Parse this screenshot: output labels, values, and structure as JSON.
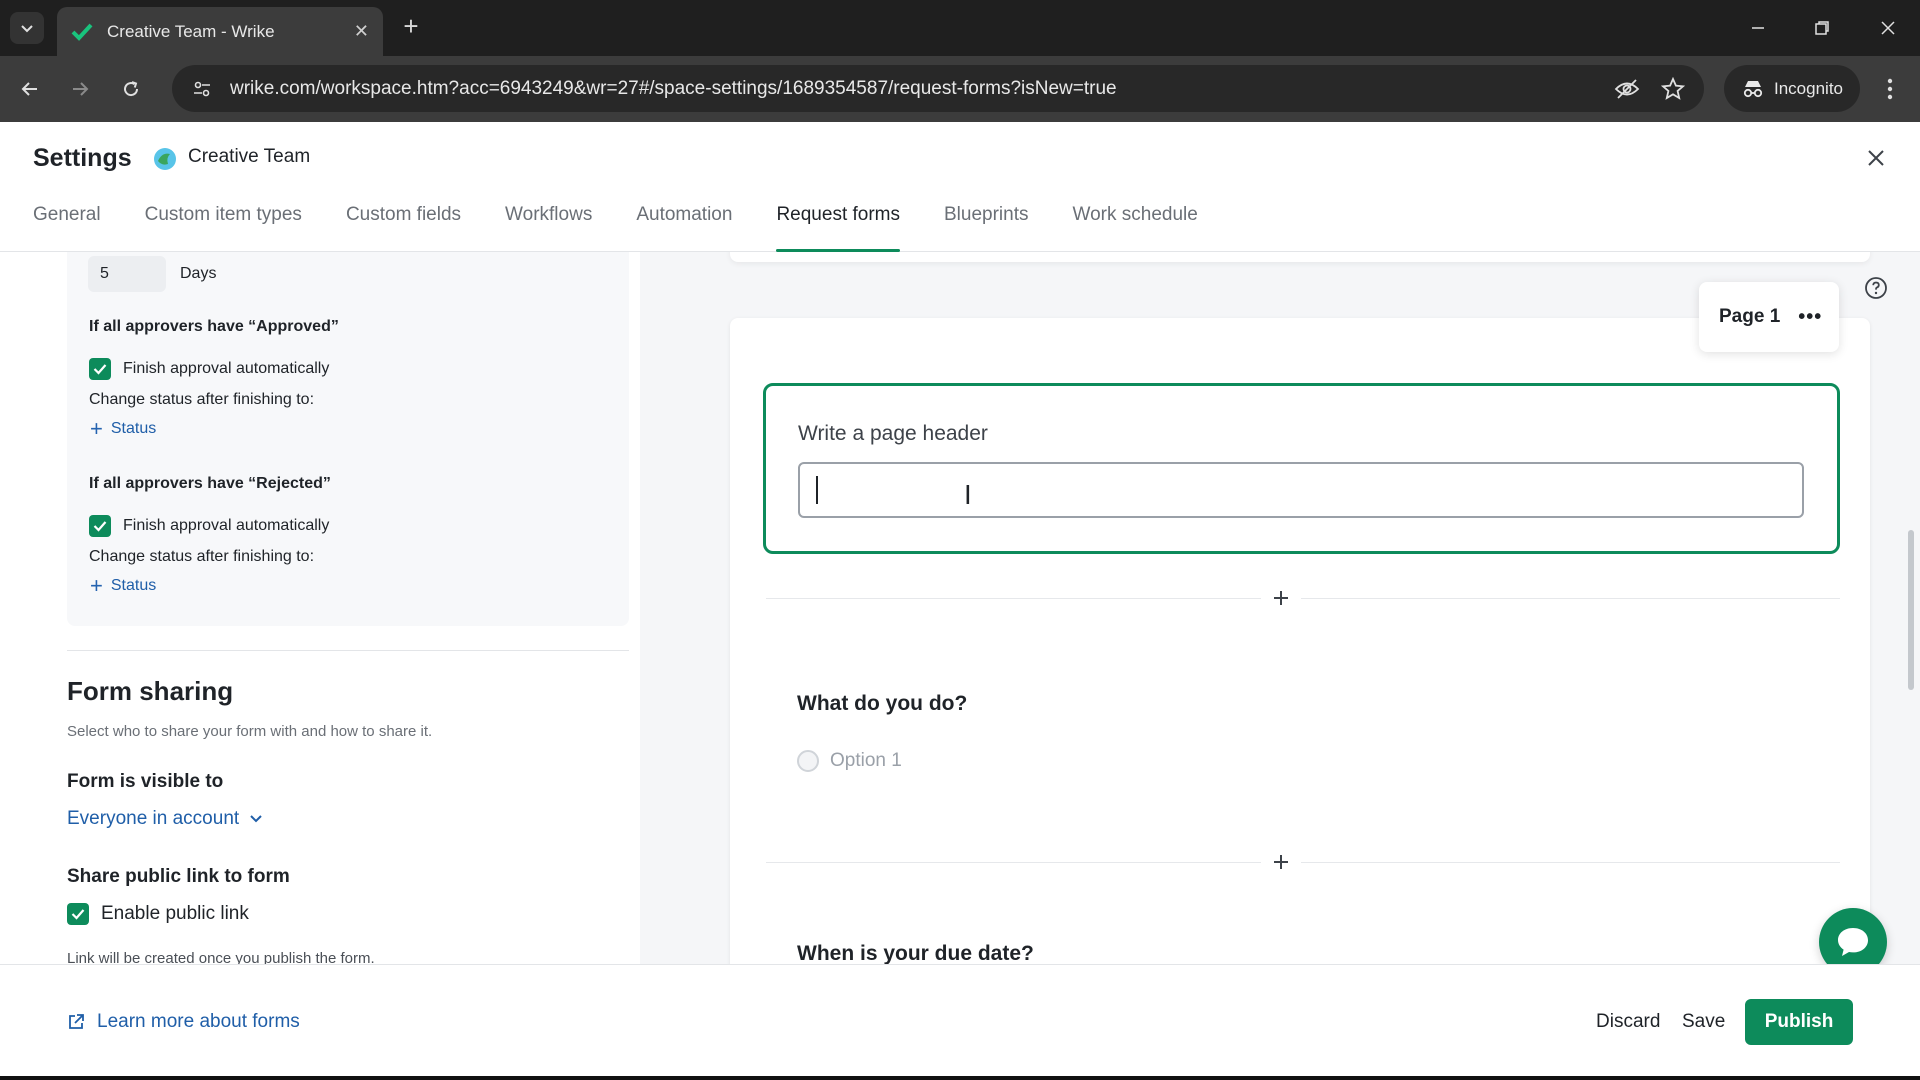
{
  "browser": {
    "tab_title": "Creative Team - Wrike",
    "url": "wrike.com/workspace.htm?acc=6943249&wr=27#/space-settings/1689354587/request-forms?isNew=true",
    "incognito_label": "Incognito"
  },
  "settings": {
    "title": "Settings",
    "space_name": "Creative Team",
    "tabs": [
      {
        "label": "General",
        "active": false
      },
      {
        "label": "Custom item types",
        "active": false
      },
      {
        "label": "Custom fields",
        "active": false
      },
      {
        "label": "Workflows",
        "active": false
      },
      {
        "label": "Automation",
        "active": false
      },
      {
        "label": "Request forms",
        "active": true
      },
      {
        "label": "Blueprints",
        "active": false
      },
      {
        "label": "Work schedule",
        "active": false
      }
    ]
  },
  "approval": {
    "days_value": "5",
    "days_label": "Days",
    "approved_heading": "If all approvers have “Approved”",
    "approved_finish": "Finish approval automatically",
    "approved_change": "Change status after finishing to:",
    "approved_status": "Status",
    "rejected_heading": "If all approvers have “Rejected”",
    "rejected_finish": "Finish approval automatically",
    "rejected_change": "Change status after finishing to:",
    "rejected_status": "Status"
  },
  "sharing": {
    "heading": "Form sharing",
    "subtitle": "Select who to share your form with and how to share it.",
    "visible_label": "Form is visible to",
    "visible_value": "Everyone in account",
    "public_link_label": "Share public link to form",
    "enable_public_link": "Enable public link",
    "note": "Link will be created once you publish the form."
  },
  "form": {
    "page_label": "Page 1",
    "header_prompt": "Write a page header",
    "header_value": "",
    "question1": "What do you do?",
    "option1": "Option 1",
    "question2": "When is your due date?"
  },
  "footer": {
    "learn_more": "Learn more about forms",
    "discard": "Discard",
    "save": "Save",
    "publish": "Publish"
  },
  "colors": {
    "accent": "#0d8b5b",
    "link": "#1f5ea8"
  }
}
